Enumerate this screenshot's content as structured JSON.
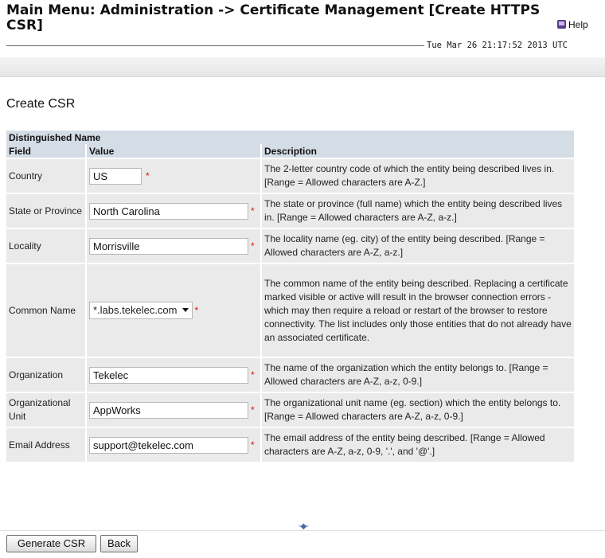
{
  "header": {
    "title": "Main Menu: Administration -> Certificate Management [Create HTTPS CSR]",
    "help_label": "Help",
    "timestamp": "Tue Mar 26 21:17:52 2013 UTC"
  },
  "page_heading": "Create CSR",
  "table": {
    "section_title": "Distinguished Name",
    "columns": [
      "Field",
      "Value",
      "Description"
    ],
    "rows": [
      {
        "field": "Country",
        "value": "US",
        "description": "The 2-letter country code of which the entity being described lives in. [Range = Allowed characters are A-Z.]"
      },
      {
        "field": "State or Province",
        "value": "North Carolina",
        "description": "The state or province (full name) which the entity being described lives in. [Range = Allowed characters are A-Z, a-z.]"
      },
      {
        "field": "Locality",
        "value": "Morrisville",
        "description": "The locality name (eg. city) of the entity being described. [Range = Allowed characters are A-Z, a-z.]"
      },
      {
        "field": "Common Name",
        "value": "*.labs.tekelec.com",
        "description": "The common name of the entity being described. Replacing a certificate marked visible or active will result in the browser connection errors - which may then require a reload or restart of the browser to restore connectivity. The list includes only those entities that do not already have an associated certificate."
      },
      {
        "field": "Organization",
        "value": "Tekelec",
        "description": "The name of the organization which the entity belongs to. [Range = Allowed characters are A-Z, a-z, 0-9.]"
      },
      {
        "field": "Organizational Unit",
        "value": "AppWorks",
        "description": "The organizational unit name (eg. section) which the entity belongs to. [Range = Allowed characters are A-Z, a-z, 0-9.]"
      },
      {
        "field": "Email Address",
        "value": "support@tekelec.com",
        "description": "The email address of the entity being described. [Range = Allowed characters are A-Z, a-z, 0-9, '.', and '@'.]"
      }
    ],
    "required_marker": "*"
  },
  "buttons": {
    "generate": "Generate CSR",
    "back": "Back"
  },
  "icons": {
    "help": "help-book-icon",
    "dropdown": "chevron-down-icon",
    "resize": "resize-handle-icon"
  },
  "colors": {
    "table_header_bg": "#d4dce6",
    "row_bg": "#eaeaea",
    "required": "#e01010"
  }
}
